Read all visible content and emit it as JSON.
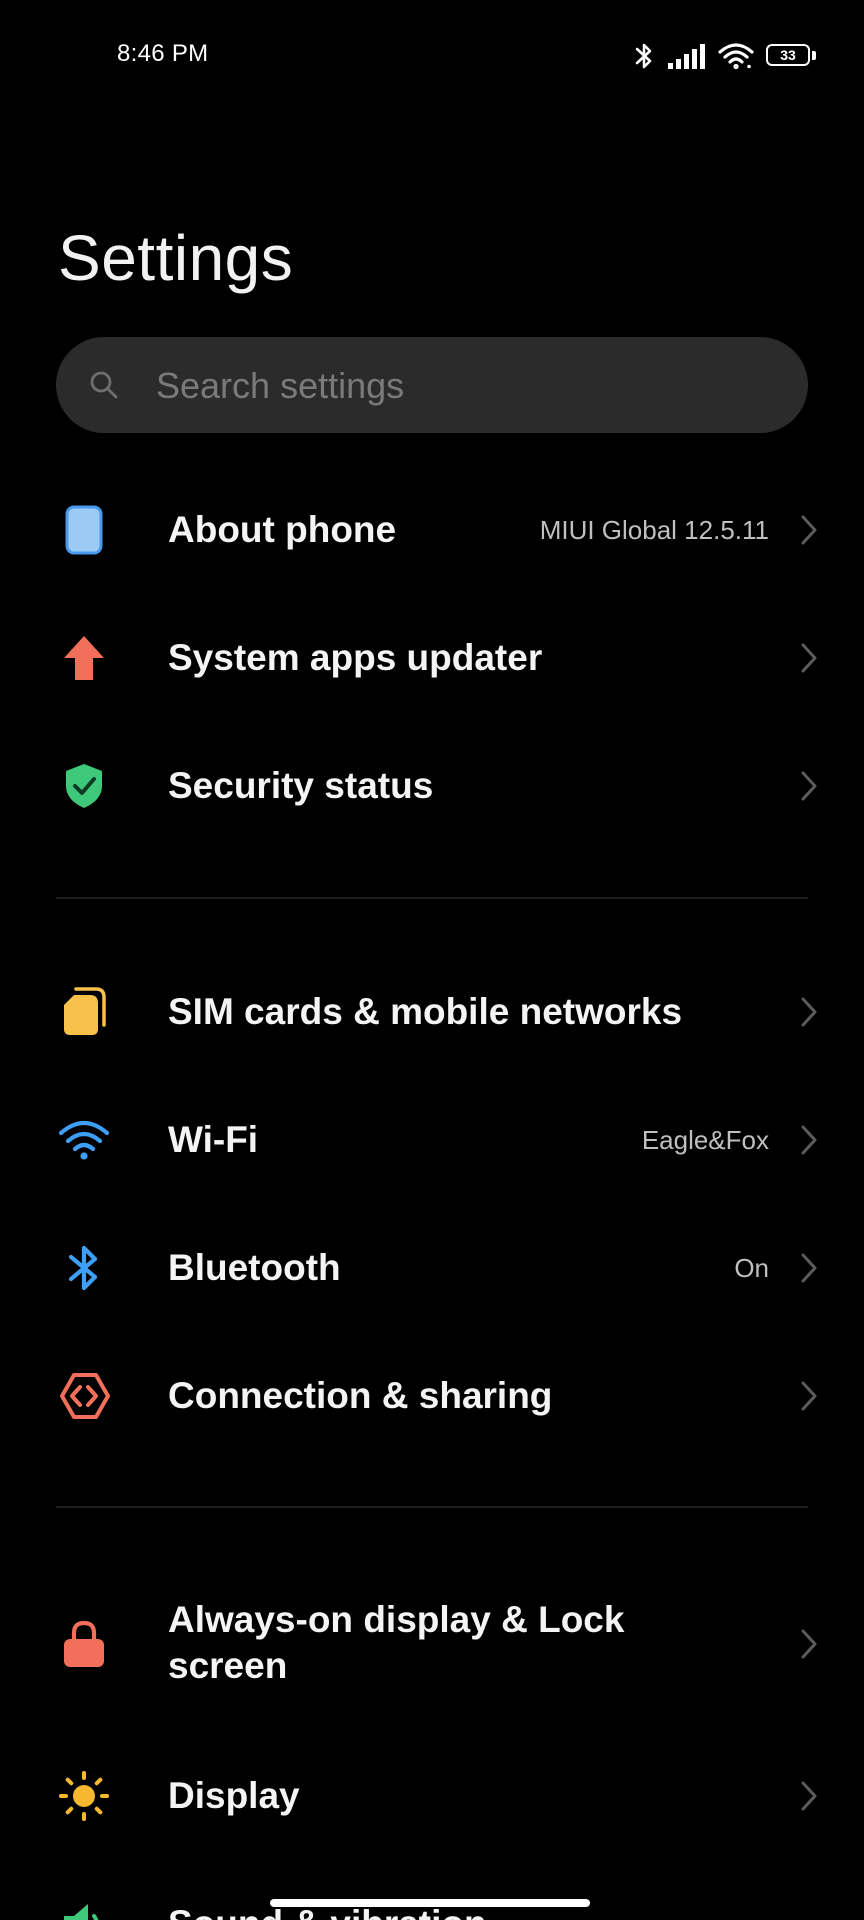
{
  "status_bar": {
    "time": "8:46 PM",
    "battery": "33"
  },
  "header": {
    "title": "Settings"
  },
  "search": {
    "placeholder": "Search settings"
  },
  "items": [
    {
      "label": "About phone",
      "value": "MIUI Global 12.5.11",
      "icon": "phone-icon",
      "color": "#5fa8f0"
    },
    {
      "label": "System apps updater",
      "value": "",
      "icon": "arrow-up-icon",
      "color": "#f2705a"
    },
    {
      "label": "Security status",
      "value": "",
      "icon": "shield-check-icon",
      "color": "#3ec97a"
    },
    {
      "label": "SIM cards & mobile networks",
      "value": "",
      "icon": "sim-card-icon",
      "color": "#f7c14a"
    },
    {
      "label": "Wi-Fi",
      "value": "Eagle&Fox",
      "icon": "wifi-icon",
      "color": "#3d9ff5"
    },
    {
      "label": "Bluetooth",
      "value": "On",
      "icon": "bluetooth-icon",
      "color": "#3d9ff5"
    },
    {
      "label": "Connection & sharing",
      "value": "",
      "icon": "connection-sharing-icon",
      "color": "#f2705a"
    },
    {
      "label": "Always-on display & Lock",
      "label_line2": "screen",
      "value": "",
      "icon": "lock-icon",
      "color": "#f2705a"
    },
    {
      "label": "Display",
      "value": "",
      "icon": "sun-icon",
      "color": "#f7b731"
    },
    {
      "label": "Sound & vibration",
      "value": "",
      "icon": "speaker-icon",
      "color": "#3ec97a"
    }
  ]
}
